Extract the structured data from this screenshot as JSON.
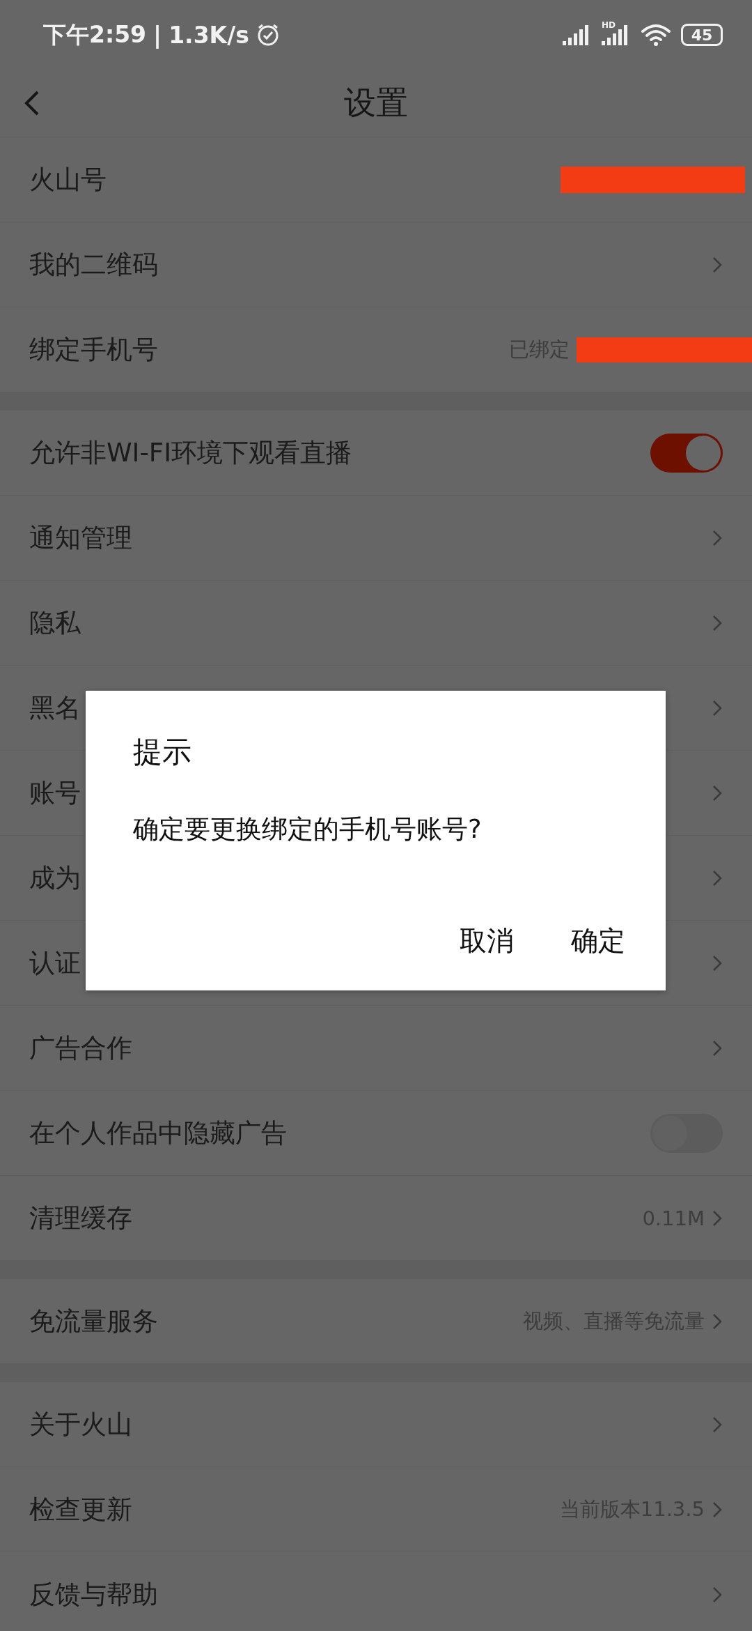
{
  "status_bar": {
    "time": "下午2:59",
    "separator": "|",
    "network_speed": "1.3K/s",
    "signal_label": "HD",
    "battery": "45"
  },
  "nav": {
    "title": "设置"
  },
  "sections": [
    {
      "rows": [
        {
          "kind": "info",
          "label": "火山号",
          "redacted": true
        },
        {
          "kind": "link",
          "label": "我的二维码"
        },
        {
          "kind": "info",
          "label": "绑定手机号",
          "value": "已绑定",
          "redacted": true
        }
      ]
    },
    {
      "rows": [
        {
          "kind": "toggle",
          "label": "允许非WI-FI环境下观看直播",
          "on": true
        },
        {
          "kind": "link",
          "label": "通知管理"
        },
        {
          "kind": "link",
          "label": "隐私"
        },
        {
          "kind": "link",
          "label": "黑名"
        },
        {
          "kind": "link",
          "label": "账号"
        },
        {
          "kind": "link",
          "label": "成为"
        },
        {
          "kind": "link",
          "label": "认证"
        },
        {
          "kind": "link",
          "label": "广告合作"
        },
        {
          "kind": "toggle",
          "label": "在个人作品中隐藏广告",
          "on": false
        },
        {
          "kind": "link",
          "label": "清理缓存",
          "value": "0.11M"
        }
      ]
    },
    {
      "rows": [
        {
          "kind": "link",
          "label": "免流量服务",
          "value": "视频、直播等免流量"
        }
      ]
    },
    {
      "rows": [
        {
          "kind": "link",
          "label": "关于火山"
        },
        {
          "kind": "link",
          "label": "检查更新",
          "value": "当前版本11.3.5"
        },
        {
          "kind": "link",
          "label": "反馈与帮助"
        }
      ]
    }
  ],
  "dialog": {
    "title": "提示",
    "message": "确定要更换绑定的手机号账号?",
    "buttons": [
      {
        "label": "取消"
      },
      {
        "label": "确定"
      }
    ]
  }
}
